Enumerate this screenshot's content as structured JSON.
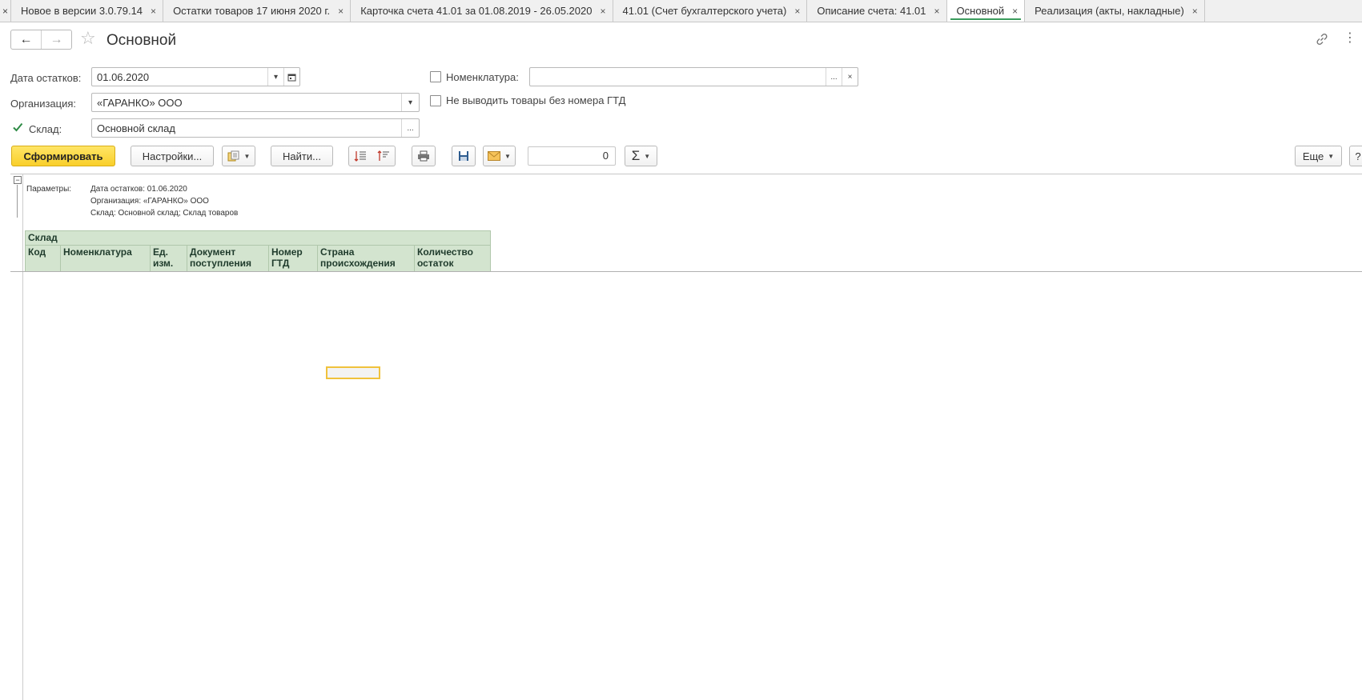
{
  "tabs": [
    {
      "label": "Новое в версии 3.0.79.14",
      "active": false
    },
    {
      "label": "Остатки товаров 17 июня 2020 г.",
      "active": false
    },
    {
      "label": "Карточка счета 41.01 за 01.08.2019 - 26.05.2020",
      "active": false
    },
    {
      "label": "41.01 (Счет бухгалтерского учета)",
      "active": false
    },
    {
      "label": "Описание счета: 41.01",
      "active": false
    },
    {
      "label": "Основной",
      "active": true
    },
    {
      "label": "Реализация (акты, накладные)",
      "active": false
    }
  ],
  "header": {
    "title": "Основной",
    "back_glyph": "←",
    "forward_glyph": "→",
    "star_glyph": "☆",
    "more_glyph": "⋮"
  },
  "form": {
    "date_label": "Дата остатков:",
    "date_value": "01.06.2020",
    "org_label": "Организация:",
    "org_value": "«ГАРАНКО» ООО",
    "warehouse_label": "Склад:",
    "warehouse_value": "Основной склад",
    "warehouse_checked": true,
    "nomenclature_label": "Номенклатура:",
    "nomenclature_value": "",
    "nomenclature_checked": false,
    "no_gtd_label": "Не выводить товары без номера ГТД",
    "no_gtd_checked": false,
    "ellipsis": "...",
    "clear": "×"
  },
  "toolbar": {
    "generate_label": "Сформировать",
    "settings_label": "Настройки...",
    "find_label": "Найти...",
    "counter_value": "0",
    "sum_glyph": "Σ",
    "more_label": "Еще",
    "help_label": "?"
  },
  "report": {
    "params_label": "Параметры:",
    "params": [
      "Дата остатков: 01.06.2020",
      "Организация: «ГАРАНКО» ООО",
      "Склад: Основной склад; Склад товаров"
    ],
    "group_header": "Склад",
    "columns": [
      "Код",
      "Номенклатура",
      "Ед. изм.",
      "Документ поступления",
      "Номер ГТД",
      "Страна происхождения",
      "Количество остаток"
    ]
  },
  "colors": {
    "accent_green": "#3a9c5c",
    "primary_yellow": "#f9cf2a",
    "table_header_bg": "#d3e4cf"
  }
}
